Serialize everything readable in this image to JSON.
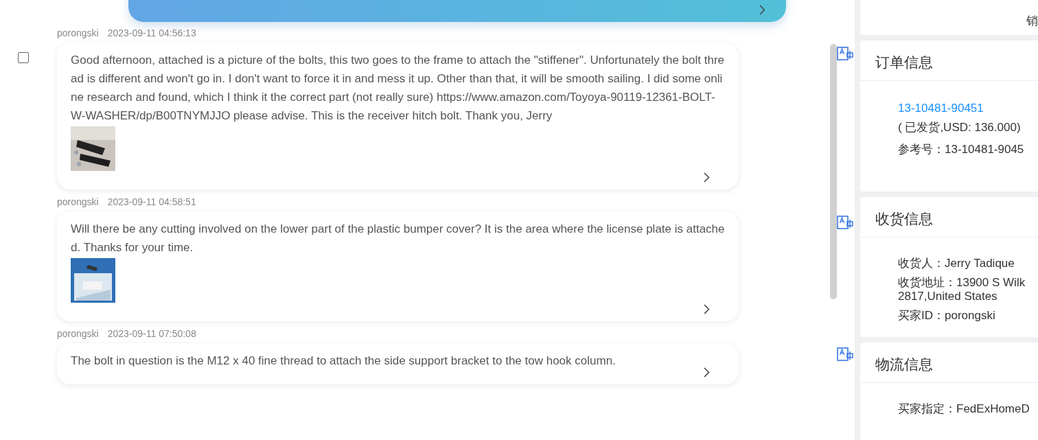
{
  "top_message": {
    "kind": "outgoing"
  },
  "messages": [
    {
      "sender": "porongski",
      "time": "2023-09-11 04:56:13",
      "checkbox": {
        "checked": false
      },
      "text": "Good afternoon, attached is a picture of the bolts, this two goes to the frame to attach the \"stiffener\". Unfortunately the bolt thread is different and won't go in. I don't want to force it in and mess it up. Other than that, it will be smooth sailing. I did some online research and found, which I think it the correct part (not really sure) https://www.amazon.com/Toyoya-90119-12361-BOLT-W-WASHER/dp/B00TNYMJJO please advise. This is the receiver hitch bolt. Thank you, Jerry"
    },
    {
      "sender": "porongski",
      "time": "2023-09-11 04:58:51",
      "text": "Will there be any cutting involved on the lower part of the plastic bumper cover? It is the area where the license plate is attached. Thanks for your time."
    },
    {
      "sender": "porongski",
      "time": "2023-09-11 07:50:08",
      "text": "The bolt in question is the M12 x 40 fine thread to attach the side support bracket to the tow hook column."
    }
  ],
  "side_panel": {
    "top_card_text": "销",
    "order": {
      "title": "订单信息",
      "order_number": "13-10481-90451",
      "status": "( 已发货,USD: 136.000)",
      "reference": "参考号：13-10481-9045"
    },
    "shipping": {
      "title": "收货信息",
      "lines": [
        "收货人：Jerry Tadique",
        "收货地址：13900 S Wilk\n2817,United States",
        "买家ID：porongski"
      ]
    },
    "logistics": {
      "title": "物流信息",
      "lines": [
        "买家指定：FedExHomeD"
      ]
    }
  }
}
